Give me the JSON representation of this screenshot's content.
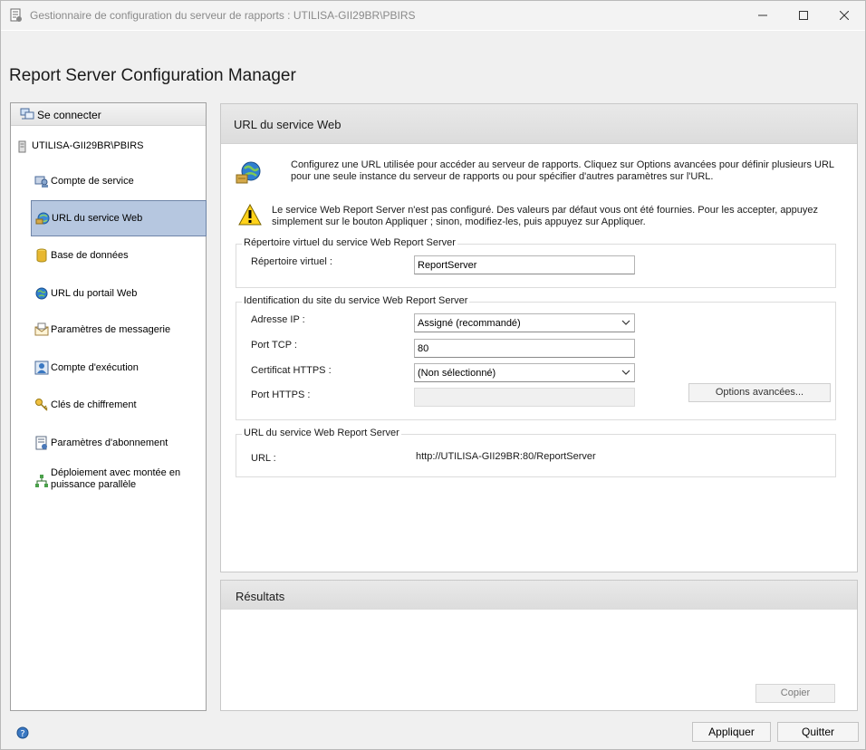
{
  "window": {
    "title": "Gestionnaire de configuration du serveur de rapports : UTILISA-GII29BR\\PBIRS",
    "app_title": "Report Server Configuration Manager"
  },
  "nav": {
    "connect_label": "Se connecter",
    "server_name": "UTILISA-GII29BR\\PBIRS",
    "items": [
      {
        "label": "Compte de service",
        "icon": "service-account-icon"
      },
      {
        "label": "URL du service Web",
        "icon": "web-service-url-icon",
        "selected": true
      },
      {
        "label": "Base de données",
        "icon": "database-icon"
      },
      {
        "label": "URL du portail Web",
        "icon": "globe-icon"
      },
      {
        "label": "Paramètres de messagerie",
        "icon": "email-icon"
      },
      {
        "label": "Compte d'exécution",
        "icon": "execution-account-icon"
      },
      {
        "label": "Clés de chiffrement",
        "icon": "keys-icon"
      },
      {
        "label": "Paramètres d'abonnement",
        "icon": "subscription-icon"
      },
      {
        "label": "Déploiement avec montée en puissance parallèle",
        "icon": "scale-out-icon"
      }
    ]
  },
  "main": {
    "title": "URL du service Web",
    "intro": "Configurez une URL utilisée pour accéder au serveur de rapports.  Cliquez sur Options avancées pour définir plusieurs URL pour une seule instance du serveur de rapports ou pour spécifier d'autres paramètres sur l'URL.",
    "warning": "Le service Web Report Server n'est pas configuré. Des valeurs par défaut vous ont été fournies. Pour les accepter, appuyez simplement sur le bouton Appliquer ; sinon, modifiez-les, puis appuyez sur Appliquer.",
    "virtual_dir_group": {
      "title": "Répertoire virtuel du service Web Report Server",
      "label": "Répertoire virtuel :",
      "value": "ReportServer"
    },
    "site_group": {
      "title": "Identification du site du service Web Report Server",
      "ip_label": "Adresse IP :",
      "ip_value": "Assigné (recommandé)",
      "tcp_label": "Port TCP :",
      "tcp_value": "80",
      "cert_label": "Certificat HTTPS :",
      "cert_value": "(Non sélectionné)",
      "https_label": "Port HTTPS :",
      "https_value": "",
      "advanced_button": "Options avancées..."
    },
    "url_group": {
      "title": "URL du service Web Report Server",
      "label": "URL :",
      "value": "http://UTILISA-GII29BR:80/ReportServer"
    }
  },
  "results": {
    "title": "Résultats",
    "copy_button": "Copier"
  },
  "footer": {
    "apply_button": "Appliquer",
    "quit_button": "Quitter"
  }
}
